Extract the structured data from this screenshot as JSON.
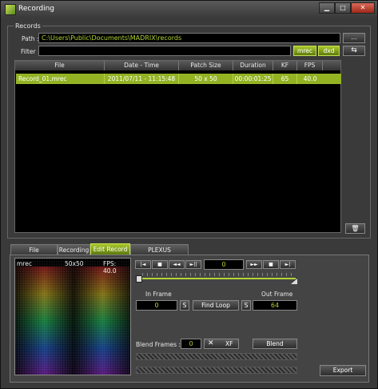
{
  "window": {
    "title": "Recording"
  },
  "records": {
    "group_label": "Records",
    "path_label": "Path :",
    "path_value": "C:\\Users\\Public\\Documents\\MADRIX\\records",
    "browse_label": "...",
    "filter_label": "Filter :",
    "filter_value": "",
    "filter_buttons": [
      "mrec",
      "dxd"
    ],
    "refresh_icon": "refresh-arrows-icon",
    "columns": [
      "File",
      "Date - Time",
      "Patch Size",
      "Duration",
      "KF",
      "FPS"
    ],
    "rows": [
      [
        "Record_01.mrec",
        "2011/07/11 - 11:15:48",
        "50 x 50",
        "00:00:01:25",
        "65",
        "40.0"
      ]
    ],
    "delete_icon": "trash-icon"
  },
  "tabs": [
    {
      "label": "File Information",
      "active": false
    },
    {
      "label": "Recording",
      "active": false
    },
    {
      "label": "Edit Record",
      "active": true
    },
    {
      "label": "PLEXUS Conversion",
      "active": false
    }
  ],
  "edit": {
    "preview_name": "mrec",
    "preview_size": "50x50",
    "preview_fps": "FPS: 40.0",
    "player_buttons": [
      "|◄",
      "■",
      "◄◄",
      "►||",
      "►►",
      "■",
      "►|"
    ],
    "frame_value": "0",
    "in_frame_label": "In Frame",
    "out_frame_label": "Out Frame",
    "in_frame_value": "0",
    "out_frame_value": "64",
    "set_label": "S",
    "find_loop_label": "Find Loop",
    "blend_frames_label": "Blend Frames :",
    "blend_frames_value": "0",
    "xf_label": "XF",
    "blend_label": "Blend",
    "export_label": "Export"
  },
  "colors": {
    "accent": "#93b323",
    "accent_text": "#b3d434",
    "background": "#3a3a3a"
  }
}
